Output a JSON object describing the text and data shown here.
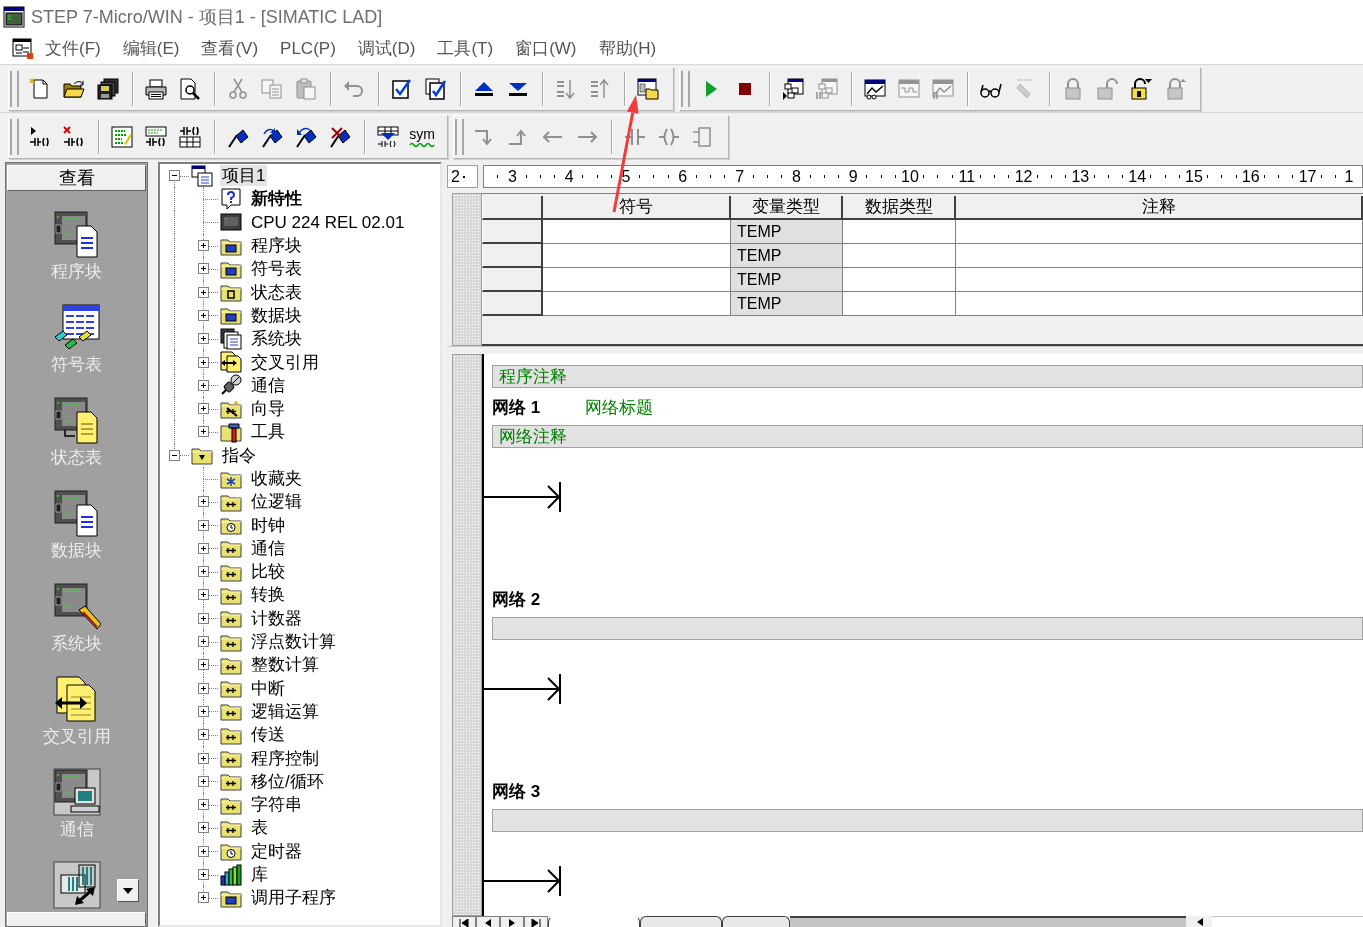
{
  "window": {
    "title": "STEP 7-Micro/WIN - 项目1 - [SIMATIC LAD]"
  },
  "menu": [
    "文件(F)",
    "编辑(E)",
    "查看(V)",
    "PLC(P)",
    "调试(D)",
    "工具(T)",
    "窗口(W)",
    "帮助(H)"
  ],
  "toolbar_rows": [
    {
      "toolbars": [
        {
          "groups": [
            [
              {
                "disabled": false
              },
              {
                "disabled": false
              },
              {
                "disabled": false
              }
            ],
            [
              {
                "disabled": false
              },
              {
                "disabled": false
              }
            ],
            [
              {
                "disabled": true
              },
              {
                "disabled": true
              },
              {
                "disabled": true
              }
            ],
            [
              {
                "disabled": true
              }
            ],
            [
              {
                "disabled": false
              },
              {
                "disabled": false
              }
            ],
            [
              {
                "disabled": false
              },
              {
                "disabled": false
              }
            ],
            [
              {
                "disabled": true
              },
              {
                "disabled": true
              }
            ],
            [
              {
                "disabled": false
              }
            ]
          ]
        },
        {
          "groups": [
            [
              {
                "disabled": false
              },
              {
                "disabled": false
              }
            ],
            [
              {
                "disabled": false
              },
              {
                "disabled": true
              }
            ],
            [
              {
                "disabled": false
              },
              {
                "disabled": true
              },
              {
                "disabled": true
              }
            ],
            [
              {
                "disabled": false
              },
              {
                "disabled": true
              }
            ],
            [
              {
                "disabled": true
              },
              {
                "disabled": true
              },
              {
                "disabled": false
              },
              {
                "disabled": true
              }
            ]
          ]
        }
      ]
    },
    {
      "toolbars": [
        {
          "groups": [
            [
              {
                "disabled": false
              },
              {
                "disabled": false
              }
            ],
            [
              {
                "disabled": false
              },
              {
                "disabled": false
              },
              {
                "disabled": false
              }
            ],
            [
              {
                "disabled": false
              },
              {
                "disabled": false
              },
              {
                "disabled": false
              },
              {
                "disabled": false
              }
            ],
            [
              {
                "disabled": false
              },
              {
                "label": "sym",
                "disabled": false
              }
            ]
          ]
        },
        {
          "groups": [
            [
              {
                "disabled": true
              },
              {
                "disabled": true
              },
              {
                "disabled": true
              },
              {
                "disabled": true
              }
            ],
            [
              {
                "disabled": true
              },
              {
                "disabled": true
              },
              {
                "disabled": true
              }
            ]
          ]
        }
      ]
    }
  ],
  "navigator": {
    "header": "查看",
    "items": [
      {
        "label": "程序块"
      },
      {
        "label": "符号表"
      },
      {
        "label": "状态表"
      },
      {
        "label": "数据块"
      },
      {
        "label": "系统块"
      },
      {
        "label": "交叉引用"
      },
      {
        "label": "通信"
      }
    ]
  },
  "project_tree": [
    {
      "label": "项目1",
      "kind": "branch",
      "expanded": true,
      "selected": true,
      "children": [
        {
          "label": "新特性",
          "kind": "leaf",
          "bold": true,
          "selected": false
        },
        {
          "label": "CPU 224 REL 02.01",
          "kind": "leaf",
          "selected": false
        },
        {
          "label": "程序块",
          "kind": "branch",
          "expanded": false,
          "selected": false
        },
        {
          "label": "符号表",
          "kind": "branch",
          "expanded": false,
          "selected": false
        },
        {
          "label": "状态表",
          "kind": "branch",
          "expanded": false,
          "selected": false
        },
        {
          "label": "数据块",
          "kind": "branch",
          "expanded": false,
          "selected": false
        },
        {
          "label": "系统块",
          "kind": "branch",
          "expanded": false,
          "selected": false
        },
        {
          "label": "交叉引用",
          "kind": "branch",
          "expanded": false,
          "selected": false
        },
        {
          "label": "通信",
          "kind": "branch",
          "expanded": false,
          "selected": false
        },
        {
          "label": "向导",
          "kind": "branch",
          "expanded": false,
          "selected": false
        },
        {
          "label": "工具",
          "kind": "branch",
          "expanded": false,
          "selected": false
        }
      ]
    },
    {
      "label": "指令",
      "kind": "branch",
      "expanded": true,
      "selected": false,
      "children": [
        {
          "label": "收藏夹",
          "kind": "leaf",
          "selected": false
        },
        {
          "label": "位逻辑",
          "kind": "branch",
          "expanded": false,
          "selected": false
        },
        {
          "label": "时钟",
          "kind": "branch",
          "expanded": false,
          "selected": false
        },
        {
          "label": "通信",
          "kind": "branch",
          "expanded": false,
          "selected": false
        },
        {
          "label": "比较",
          "kind": "branch",
          "expanded": false,
          "selected": false
        },
        {
          "label": "转换",
          "kind": "branch",
          "expanded": false,
          "selected": false
        },
        {
          "label": "计数器",
          "kind": "branch",
          "expanded": false,
          "selected": false
        },
        {
          "label": "浮点数计算",
          "kind": "branch",
          "expanded": false,
          "selected": false
        },
        {
          "label": "整数计算",
          "kind": "branch",
          "expanded": false,
          "selected": false
        },
        {
          "label": "中断",
          "kind": "branch",
          "expanded": false,
          "selected": false
        },
        {
          "label": "逻辑运算",
          "kind": "branch",
          "expanded": false,
          "selected": false
        },
        {
          "label": "传送",
          "kind": "branch",
          "expanded": false,
          "selected": false
        },
        {
          "label": "程序控制",
          "kind": "branch",
          "expanded": false,
          "selected": false
        },
        {
          "label": "移位/循环",
          "kind": "branch",
          "expanded": false,
          "selected": false
        },
        {
          "label": "字符串",
          "kind": "branch",
          "expanded": false,
          "selected": false
        },
        {
          "label": "表",
          "kind": "branch",
          "expanded": false,
          "selected": false
        },
        {
          "label": "定时器",
          "kind": "branch",
          "expanded": false,
          "selected": false
        },
        {
          "label": "库",
          "kind": "branch",
          "expanded": false,
          "selected": false
        },
        {
          "label": "调用子程序",
          "kind": "branch",
          "expanded": false,
          "selected": false
        }
      ]
    }
  ],
  "editor": {
    "ruler": {
      "origin": "2",
      "marks": [
        "3",
        "4",
        "5",
        "6",
        "7",
        "8",
        "9",
        "10",
        "11",
        "12",
        "13",
        "14",
        "15",
        "16",
        "17",
        "1"
      ]
    },
    "local_vars": {
      "columns": [
        "符号",
        "变量类型",
        "数据类型",
        "注释"
      ],
      "rows": [
        {
          "var_type": "TEMP"
        },
        {
          "var_type": "TEMP"
        },
        {
          "var_type": "TEMP"
        },
        {
          "var_type": "TEMP"
        }
      ]
    },
    "program_comment": "程序注释",
    "networks": [
      {
        "label": "网络 1",
        "title": "网络标题",
        "comment": "网络注释"
      },
      {
        "label": "网络 2"
      },
      {
        "label": "网络 3"
      }
    ],
    "sheet_tabs": [
      {
        "selected": true
      },
      {
        "selected": false
      },
      {
        "selected": false
      }
    ]
  }
}
